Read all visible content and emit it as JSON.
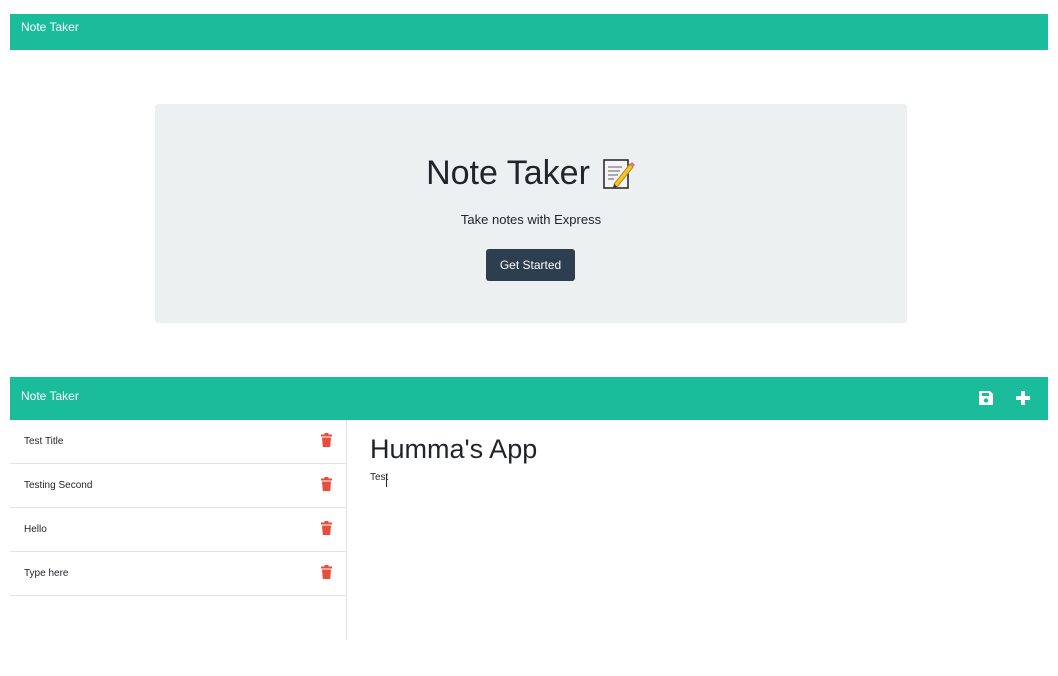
{
  "top_nav": {
    "brand": "Note Taker"
  },
  "hero": {
    "title": "Note Taker",
    "subtitle": "Take notes with Express",
    "button_label": "Get Started",
    "emoji_icon": "memo-icon"
  },
  "app_nav": {
    "brand": "Note Taker",
    "icons": [
      "save-icon",
      "plus-icon"
    ]
  },
  "notes": [
    {
      "title": "Test Title"
    },
    {
      "title": "Testing Second"
    },
    {
      "title": "Hello"
    },
    {
      "title": "Type here"
    }
  ],
  "editor": {
    "title_value": "Humma's App",
    "text_value": "Test"
  },
  "colors": {
    "navbar": "#1abc9c",
    "jumbotron": "#ecf0f1",
    "button": "#2c3e50",
    "trash": "#e74c3c"
  }
}
